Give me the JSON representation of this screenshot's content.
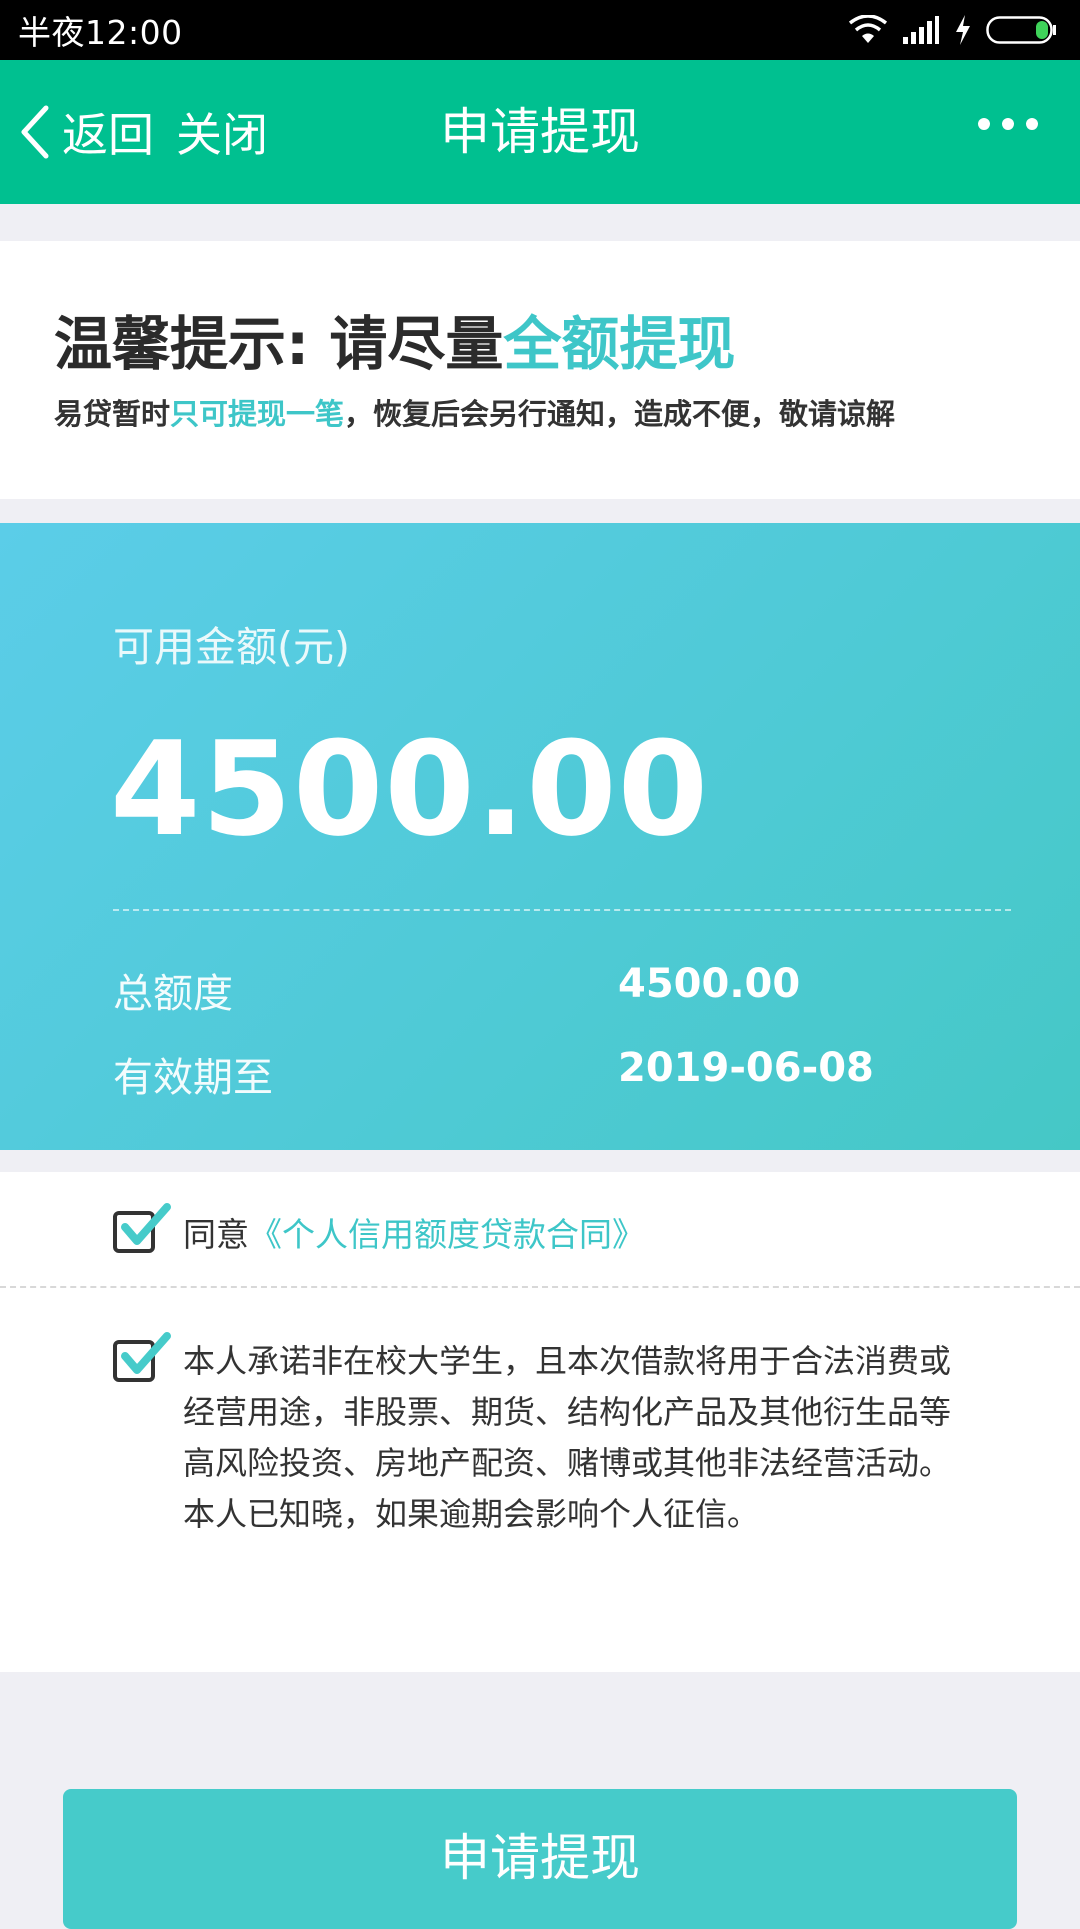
{
  "status_bar": {
    "time": "半夜12:00"
  },
  "nav": {
    "back_label": "返回",
    "close_label": "关闭",
    "title": "申请提现"
  },
  "notice": {
    "title_prefix": "温馨提示: 请尽量",
    "title_highlight": "全额提现",
    "sub_prefix": "易贷暂时",
    "sub_highlight": "只可提现一笔",
    "sub_suffix": "，恢复后会另行通知，造成不便，敬请谅解"
  },
  "amount": {
    "label": "可用金额(元)",
    "value": "4500.00",
    "total_label": "总额度",
    "total_value": "4500.00",
    "expiry_label": "有效期至",
    "expiry_value": "2019-06-08"
  },
  "agreement": {
    "agree_prefix": "同意",
    "contract_link": "《个人信用额度贷款合同》",
    "pledge_text": "本人承诺非在校大学生，且本次借款将用于合法消费或经营用途，非股票、期货、结构化产品及其他衍生品等高风险投资、房地产配资、赌博或其他非法经营活动。本人已知晓，如果逾期会影响个人征信。"
  },
  "submit": {
    "label": "申请提现"
  },
  "colors": {
    "nav_green": "#00c090",
    "accent_teal": "#3ec6c8",
    "button_teal": "#46cbca"
  },
  "icons": {
    "back": "chevron-left-icon",
    "more": "more-dots-icon",
    "wifi": "wifi-icon",
    "signal": "signal-icon",
    "charging": "charging-bolt-icon",
    "battery": "battery-icon",
    "check": "checkmark-icon"
  }
}
